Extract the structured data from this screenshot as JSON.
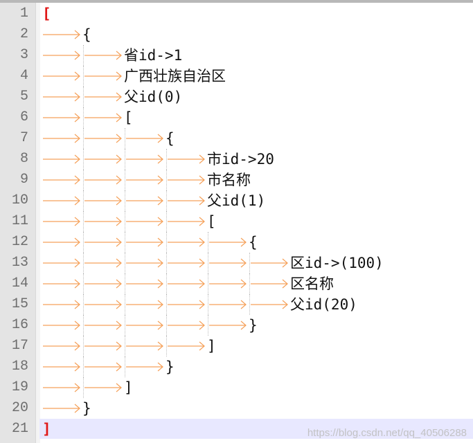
{
  "editor": {
    "colors": {
      "gutter_background": "#e4e4e4",
      "line_number_color": "#6e6e6e",
      "tab_arrow_color": "#f5a15a",
      "outer_bracket_color": "#e01818",
      "current_line_background": "#e8e8ff"
    },
    "tab_symbol": "tab-arrow-icon",
    "current_line": 21,
    "lines": [
      {
        "n": "1",
        "indent": 0,
        "text": "["
      },
      {
        "n": "2",
        "indent": 1,
        "text": "{"
      },
      {
        "n": "3",
        "indent": 2,
        "text": "省id->1"
      },
      {
        "n": "4",
        "indent": 2,
        "text": "广西壮族自治区"
      },
      {
        "n": "5",
        "indent": 2,
        "text": "父id(0)"
      },
      {
        "n": "6",
        "indent": 2,
        "text": "["
      },
      {
        "n": "7",
        "indent": 3,
        "text": "{"
      },
      {
        "n": "8",
        "indent": 4,
        "text": "市id->20"
      },
      {
        "n": "9",
        "indent": 4,
        "text": "市名称"
      },
      {
        "n": "10",
        "indent": 4,
        "text": "父id(1)"
      },
      {
        "n": "11",
        "indent": 4,
        "text": "["
      },
      {
        "n": "12",
        "indent": 5,
        "text": "{"
      },
      {
        "n": "13",
        "indent": 6,
        "text": "区id->(100)"
      },
      {
        "n": "14",
        "indent": 6,
        "text": "区名称"
      },
      {
        "n": "15",
        "indent": 6,
        "text": "父id(20)"
      },
      {
        "n": "16",
        "indent": 5,
        "text": "}"
      },
      {
        "n": "17",
        "indent": 4,
        "text": "]"
      },
      {
        "n": "18",
        "indent": 3,
        "text": "}"
      },
      {
        "n": "19",
        "indent": 2,
        "text": "]"
      },
      {
        "n": "20",
        "indent": 1,
        "text": "}"
      },
      {
        "n": "21",
        "indent": 0,
        "text": "]"
      }
    ]
  },
  "watermark": "https://blog.csdn.net/qq_40506288"
}
